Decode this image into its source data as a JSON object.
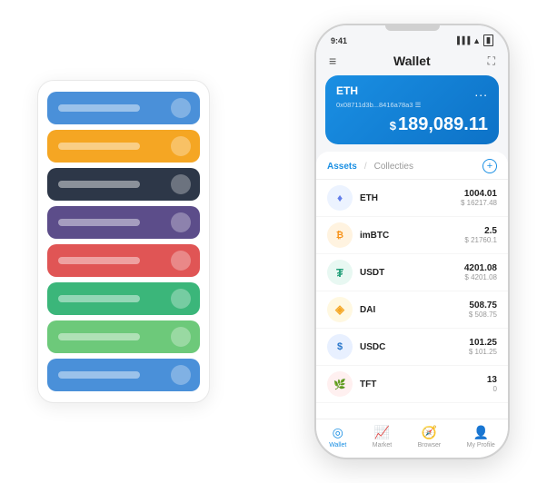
{
  "scene": {
    "cardStack": {
      "cards": [
        {
          "id": "card-1",
          "color": "card-blue"
        },
        {
          "id": "card-2",
          "color": "card-yellow"
        },
        {
          "id": "card-3",
          "color": "card-dark"
        },
        {
          "id": "card-4",
          "color": "card-purple"
        },
        {
          "id": "card-5",
          "color": "card-red"
        },
        {
          "id": "card-6",
          "color": "card-green"
        },
        {
          "id": "card-7",
          "color": "card-light-green"
        },
        {
          "id": "card-8",
          "color": "card-blue2"
        }
      ]
    },
    "phone": {
      "statusBar": {
        "time": "9:41",
        "signal": "●●●",
        "wifi": "▲",
        "battery": "▮"
      },
      "header": {
        "menuIcon": "≡",
        "title": "Wallet",
        "expandIcon": "⛶"
      },
      "ethCard": {
        "label": "ETH",
        "dots": "...",
        "address": "0x08711d3b...8416a78a3 ☰",
        "currencySymbol": "$",
        "amount": "189,089.11"
      },
      "assetsSection": {
        "activeTab": "Assets",
        "divider": "/",
        "inactiveTab": "Collecties",
        "addIcon": "+",
        "assets": [
          {
            "id": "eth",
            "logoClass": "logo-eth",
            "logoText": "♦",
            "name": "ETH",
            "amount": "1004.01",
            "usd": "$ 16217.48"
          },
          {
            "id": "imbtc",
            "logoClass": "logo-imbtc",
            "logoText": "₿",
            "name": "imBTC",
            "amount": "2.5",
            "usd": "$ 21760.1"
          },
          {
            "id": "usdt",
            "logoClass": "logo-usdt",
            "logoText": "₮",
            "name": "USDT",
            "amount": "4201.08",
            "usd": "$ 4201.08"
          },
          {
            "id": "dai",
            "logoClass": "logo-dai",
            "logoText": "◈",
            "name": "DAI",
            "amount": "508.75",
            "usd": "$ 508.75"
          },
          {
            "id": "usdc",
            "logoClass": "logo-usdc",
            "logoText": "$",
            "name": "USDC",
            "amount": "101.25",
            "usd": "$ 101.25"
          },
          {
            "id": "tft",
            "logoClass": "logo-tft",
            "logoText": "🌿",
            "name": "TFT",
            "amount": "13",
            "usd": "0"
          }
        ]
      },
      "bottomNav": [
        {
          "id": "wallet",
          "icon": "◎",
          "label": "Wallet",
          "active": true
        },
        {
          "id": "market",
          "icon": "📊",
          "label": "Market",
          "active": false
        },
        {
          "id": "browser",
          "icon": "🌐",
          "label": "Browser",
          "active": false
        },
        {
          "id": "profile",
          "icon": "👤",
          "label": "My Profile",
          "active": false
        }
      ]
    }
  }
}
